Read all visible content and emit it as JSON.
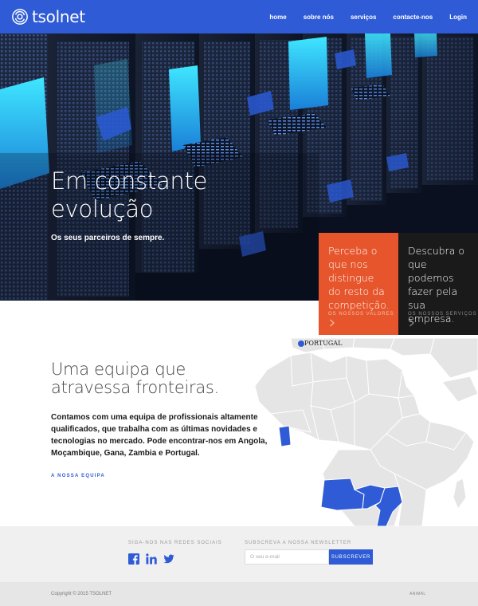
{
  "header": {
    "logo_text": "tsolnet",
    "nav": [
      "home",
      "sobre nós",
      "serviços",
      "contacte-nos",
      "Login"
    ],
    "color": "#2f5bd6"
  },
  "hero": {
    "title_line1": "Em constante",
    "title_line2": "evolução",
    "subtitle": "Os seus parceiros de sempre."
  },
  "boxes": [
    {
      "text": "Perceba o que nos distingue do resto da competição.",
      "link": "OS NOSSOS VALORES",
      "color": "#e6552c"
    },
    {
      "text": "Descubra o que podemos fazer pela sua empresa.",
      "link": "OS NOSSOS SERVIÇOS",
      "color": "#1a1a1a"
    }
  ],
  "team": {
    "title_line1": "Uma equipa que",
    "title_line2": "atravessa fronteiras.",
    "text": "Contamos com uma equipa de profissionais altamente qualificados, que trabalha com as últimas novidades e tecnologias no mercado. Pode encontrar-nos em Angola, Moçambique, Gana, Zambia e Portugal.",
    "link": "A NOSSA EQUIPA",
    "map_label": "PORTUGAL",
    "highlight_color": "#2f5bd6"
  },
  "footer": {
    "social_label": "SIGA-NOS NAS REDES SOCIAIS",
    "social_icons": [
      "facebook-icon",
      "linkedin-icon",
      "twitter-icon"
    ],
    "newsletter_label": "SUBSCREVA A NOSSA NEWSLETTER",
    "newsletter_placeholder": "O seu e-mail",
    "subscribe_label": "SUBSCREVER",
    "copyright": "Copyright © 2015 TSOLNET",
    "credit": "ANIMAL"
  }
}
